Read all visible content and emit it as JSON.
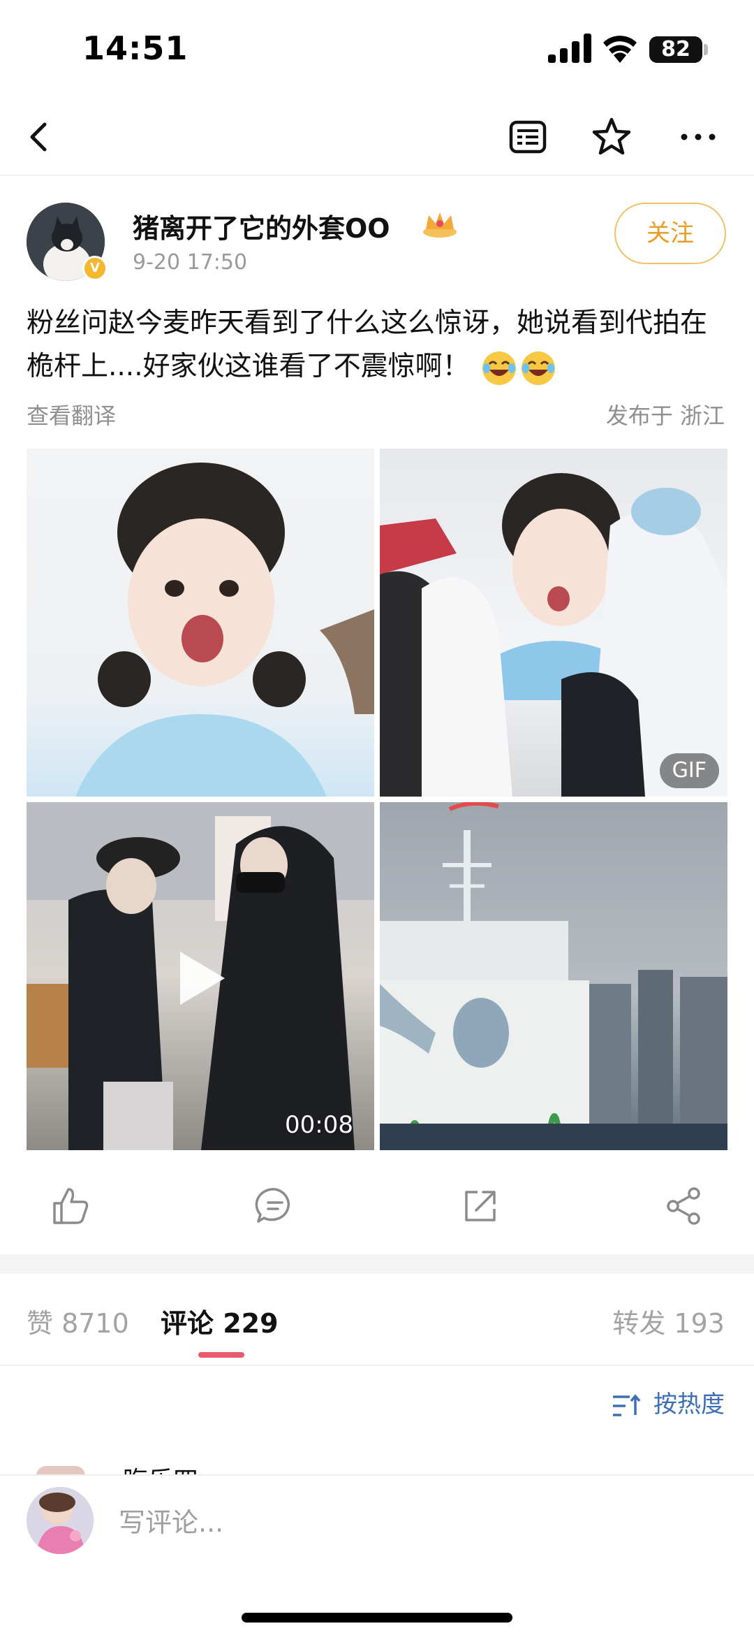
{
  "status_bar": {
    "time": "14:51",
    "battery": "82"
  },
  "nav": {
    "icons": [
      "back-arrow-icon",
      "article-list-icon",
      "star-icon",
      "more-icon"
    ]
  },
  "post": {
    "username": "猪离开了它的外套OO",
    "time": "9-20 17:50",
    "follow_label": "关注",
    "text": "粉丝问赵今麦昨天看到了什么这么惊讶，她说看到代拍在桅杆上....好家伙这谁看了不震惊啊！",
    "translate_label": "查看翻译",
    "location": "发布于 浙江",
    "media": [
      {
        "type": "image"
      },
      {
        "type": "gif",
        "badge": "GIF"
      },
      {
        "type": "video",
        "duration": "00:08"
      },
      {
        "type": "image"
      }
    ]
  },
  "actions": [
    "like-icon",
    "comment-icon",
    "repost-icon",
    "share-icon"
  ],
  "tabs": {
    "likes": "赞 8710",
    "comments": "评论 229",
    "reposts": "转发 193"
  },
  "sort_label": "按热度",
  "comment_peek": "晦乐四",
  "comment_bar": {
    "placeholder": "写评论..."
  },
  "colors": {
    "accent_follow": "#e89d2a",
    "tab_indicator": "#ea5a6a",
    "link_blue": "#3d6fb7"
  }
}
